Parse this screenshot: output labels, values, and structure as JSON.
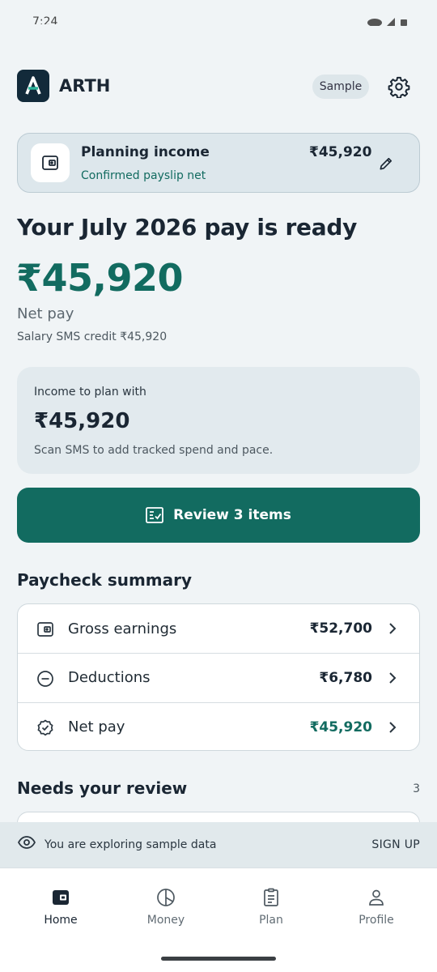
{
  "status_bar": {
    "time": "7:24"
  },
  "app": {
    "name": "ARTH",
    "mode_chip": "Sample"
  },
  "income_card": {
    "title": "Planning income",
    "subtitle": "Confirmed payslip net",
    "amount": "₹45,920"
  },
  "hero": {
    "headline": "Your July 2026 pay is ready",
    "amount": "₹45,920",
    "label": "Net pay",
    "sms_credit": "Salary SMS credit ₹45,920"
  },
  "plan_card": {
    "label": "Income to plan with",
    "amount": "₹45,920",
    "note": "Scan SMS to add tracked spend and pace."
  },
  "review_button": {
    "label": "Review 3 items"
  },
  "paycheck_summary": {
    "title": "Paycheck summary",
    "rows": [
      {
        "label": "Gross earnings",
        "value": "₹52,700",
        "icon": "wallet-icon"
      },
      {
        "label": "Deductions",
        "value": "₹6,780",
        "icon": "minus-circle-icon"
      },
      {
        "label": "Net pay",
        "value": "₹45,920",
        "icon": "verified-badge-icon"
      }
    ]
  },
  "needs_review": {
    "title": "Needs your review",
    "count": "3"
  },
  "sample_banner": {
    "text": "You are exploring sample data",
    "action": "SIGN UP"
  },
  "bottom_nav": {
    "items": [
      {
        "label": "Home",
        "icon": "wallet-icon",
        "active": true
      },
      {
        "label": "Money",
        "icon": "pie-chart-icon",
        "active": false
      },
      {
        "label": "Plan",
        "icon": "clipboard-icon",
        "active": false
      },
      {
        "label": "Profile",
        "icon": "person-icon",
        "active": false
      }
    ]
  },
  "colors": {
    "accent": "#126b60",
    "background": "#f0f4f6",
    "card": "#e2eaee",
    "dark_text": "#1a2633"
  }
}
